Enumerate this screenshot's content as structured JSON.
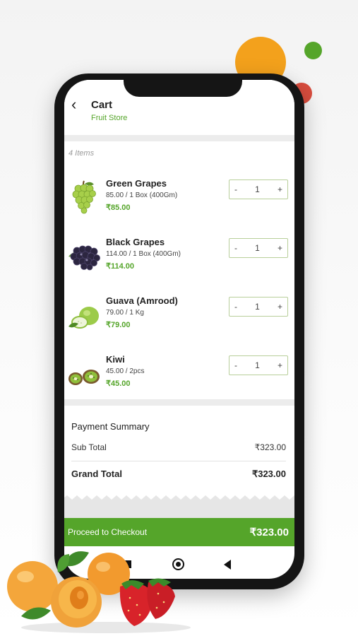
{
  "header": {
    "title": "Cart",
    "subtitle": "Fruit Store"
  },
  "items_count": "4 Items",
  "items": [
    {
      "name": "Green Grapes",
      "desc": "85.00 / 1 Box (400Gm)",
      "price": "₹85.00",
      "qty": "1",
      "icon": "green-grapes"
    },
    {
      "name": "Black Grapes",
      "desc": "114.00 / 1 Box (400Gm)",
      "price": "₹114.00",
      "qty": "1",
      "icon": "black-grapes"
    },
    {
      "name": "Guava (Amrood)",
      "desc": "79.00 / 1 Kg",
      "price": "₹79.00",
      "qty": "1",
      "icon": "guava"
    },
    {
      "name": "Kiwi",
      "desc": "45.00 / 2pcs",
      "price": "₹45.00",
      "qty": "1",
      "icon": "kiwi"
    }
  ],
  "stepper": {
    "minus": "-",
    "plus": "+"
  },
  "payment": {
    "title": "Payment Summary",
    "subtotal_label": "Sub Total",
    "subtotal_value": "₹323.00",
    "grand_label": "Grand Total",
    "grand_value": "₹323.00"
  },
  "checkout": {
    "label": "Proceed to Checkout",
    "amount": "₹323.00"
  },
  "colors": {
    "accent": "#55a52a",
    "orange": "#f3a11c",
    "red": "#d94d3e",
    "phone": "#151515"
  }
}
